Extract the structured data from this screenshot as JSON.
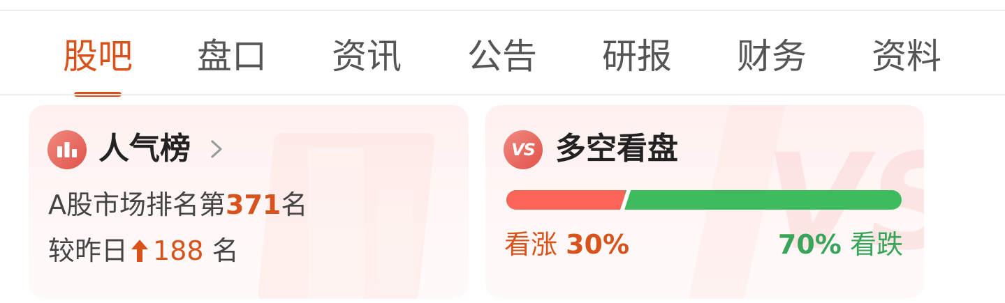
{
  "tabs": [
    {
      "label": "股吧",
      "active": true
    },
    {
      "label": "盘口",
      "active": false
    },
    {
      "label": "资讯",
      "active": false
    },
    {
      "label": "公告",
      "active": false
    },
    {
      "label": "研报",
      "active": false
    },
    {
      "label": "财务",
      "active": false
    },
    {
      "label": "资料",
      "active": false
    }
  ],
  "popularity": {
    "icon": "bar-chart-icon",
    "title": "人气榜",
    "rank_prefix": "A股市场排名第",
    "rank_value": "371",
    "rank_suffix": "名",
    "change_prefix": "较昨日",
    "change_direction": "up",
    "change_value": "188",
    "change_suffix": " 名"
  },
  "sentiment": {
    "icon": "vs-icon",
    "icon_text": "VS",
    "title": "多空看盘",
    "bull_label": "看涨",
    "bull_percent_text": "30%",
    "bull_fraction": 0.3,
    "bear_label": "看跌",
    "bear_percent_text": "70%",
    "bear_fraction": 0.7
  },
  "colors": {
    "accent": "#d8531c",
    "bull": "#fa6557",
    "bear": "#3dbb5e",
    "bear_text": "#3aa55a"
  }
}
